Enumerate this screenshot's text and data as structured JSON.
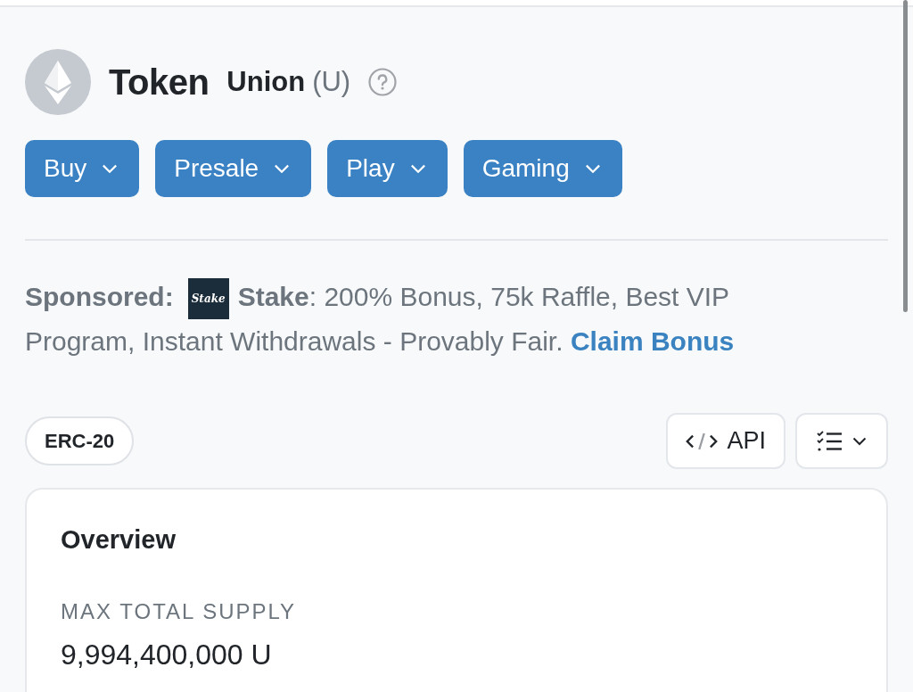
{
  "token": {
    "prefix": "Token",
    "name": "Union",
    "symbol": "(U)"
  },
  "menu_buttons": [
    {
      "label": "Buy"
    },
    {
      "label": "Presale"
    },
    {
      "label": "Play"
    },
    {
      "label": "Gaming"
    }
  ],
  "sponsored": {
    "label": "Sponsored:",
    "logo_text": "Stake",
    "text": "**Stake**: 200% Bonus, 75k Raffle, Best VIP Program, Instant Withdrawals - Provably Fair.",
    "link": "Claim Bonus"
  },
  "toolbar": {
    "badge": "ERC-20",
    "api_button": "API"
  },
  "overview": {
    "title": "Overview",
    "fields": [
      {
        "label": "MAX TOTAL SUPPLY",
        "value": "9,994,400,000 U"
      }
    ]
  }
}
